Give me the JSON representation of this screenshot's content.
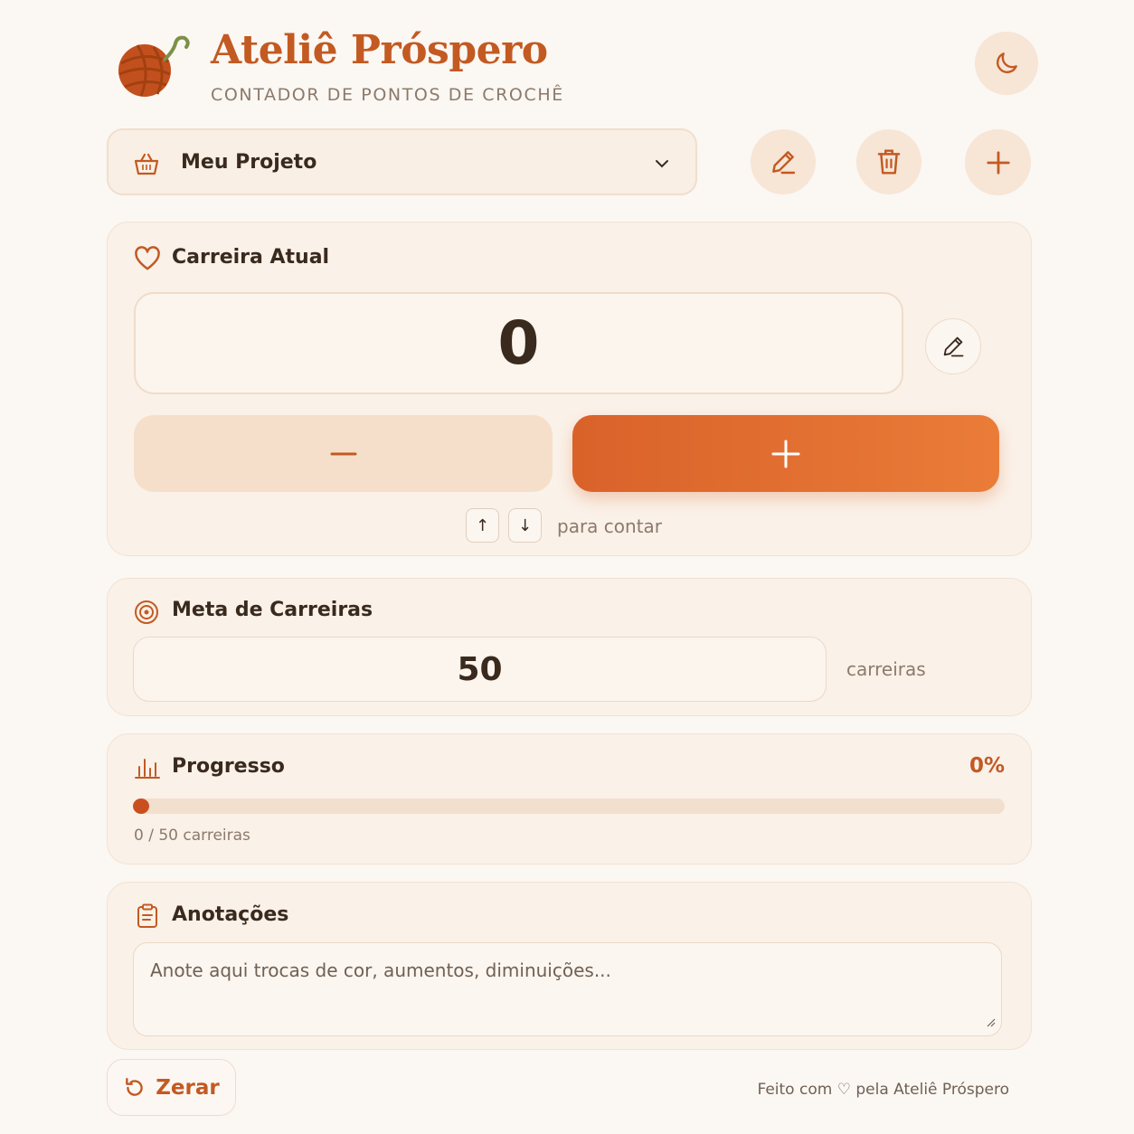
{
  "header": {
    "title": "Ateliê Próspero",
    "subtitle": "CONTADOR DE PONTOS DE CROCHÊ",
    "logo_icon": "yarn-ball-icon",
    "theme_icon": "moon-icon"
  },
  "project": {
    "selected": "Meu Projeto",
    "icon": "basket-icon",
    "actions": [
      "edit-icon",
      "trash-icon",
      "plus-icon"
    ]
  },
  "counter": {
    "title": "Carreira Atual",
    "value": "0",
    "decrement_label": "−",
    "increment_label": "+",
    "key_up": "↑",
    "key_down": "↓",
    "hint": "para contar"
  },
  "goal": {
    "title": "Meta de Carreiras",
    "value": "50",
    "unit": "carreiras"
  },
  "progress": {
    "title": "Progresso",
    "percent_label": "0%",
    "fraction": 0,
    "caption": "0 / 50 carreiras"
  },
  "notes": {
    "title": "Anotações",
    "placeholder": "Anote aqui trocas de cor, aumentos, diminuições..."
  },
  "footer": {
    "reset_label": "Zerar",
    "credit": "Feito com ♡ pela Ateliê Próspero"
  },
  "colors": {
    "accent": "#c25a22",
    "button_gradient_start": "#d9622a",
    "button_gradient_end": "#ea7c38",
    "background": "#fbf7f3",
    "card": "#faf1e8"
  }
}
